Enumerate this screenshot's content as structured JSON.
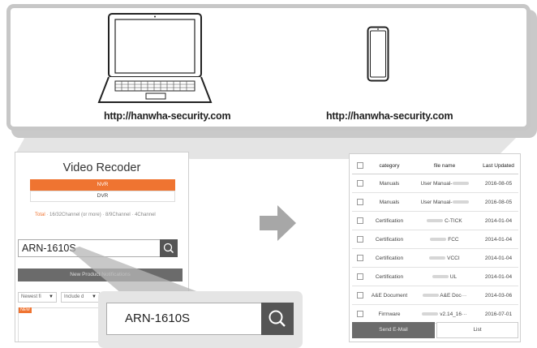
{
  "devices": {
    "laptop_url": "http://hanwha-security.com",
    "phone_url": "http://hanwha-security.com"
  },
  "left_panel": {
    "title": "Video Recoder",
    "nvr_label": "NVR",
    "dvr_label": "DVR",
    "filter_total": "Total",
    "filter_rest": " · 16/32Channel (or more) · 8/9Channel · 4Channel",
    "search_value": "ARN-1610S",
    "new_product_notifications": "New Product Notifications",
    "sort_select": "Newest fi",
    "include_select": "Include d",
    "new_badge": "NEW"
  },
  "zoom": {
    "search_value": "ARN-1610S"
  },
  "right_panel": {
    "headers": [
      "category",
      "file name",
      "Last Updated"
    ],
    "rows": [
      {
        "category": "Manuals",
        "file": "User Manual-",
        "suffix": "",
        "date": "2016-08-05"
      },
      {
        "category": "Manuals",
        "file": "User Manual-",
        "suffix": "",
        "date": "2016-08-05"
      },
      {
        "category": "Certification",
        "file": "",
        "suffix": "C-TICK",
        "date": "2014-01-04"
      },
      {
        "category": "Certification",
        "file": "",
        "suffix": "FCC",
        "date": "2014-01-04"
      },
      {
        "category": "Certification",
        "file": "",
        "suffix": "VCCI",
        "date": "2014-01-04"
      },
      {
        "category": "Certification",
        "file": "",
        "suffix": "UL",
        "date": "2014-01-04"
      },
      {
        "category": "A&E Document",
        "file": "",
        "suffix": "A&E Doc···",
        "date": "2014-03-06"
      },
      {
        "category": "Firmware",
        "file": "",
        "suffix": "v2.14_16···",
        "date": "2016-07-01"
      }
    ],
    "send_email": "Send E-Mail",
    "list": "List"
  },
  "colors": {
    "accent": "#ef7431",
    "dark_button": "#555555",
    "frame": "#c7c7c7"
  }
}
